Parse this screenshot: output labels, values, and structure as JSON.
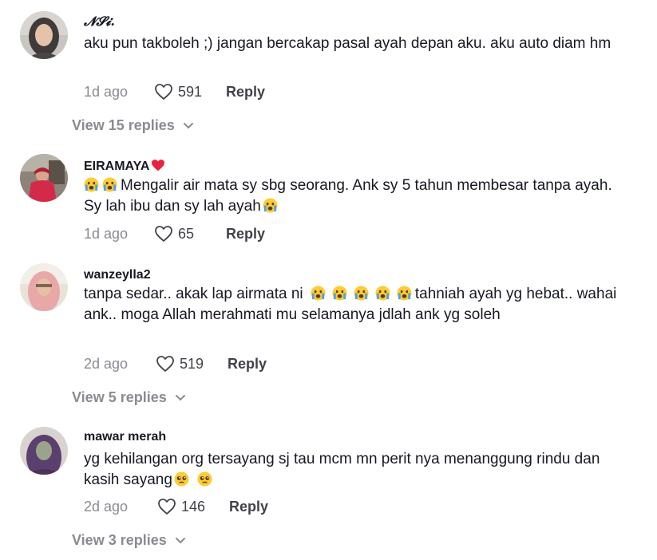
{
  "comments": [
    {
      "username": "𝓝𝓢𝓲.",
      "text": "aku pun takboleh ;) jangan bercakap pasal ayah depan aku. aku auto diam hm",
      "time": "1d ago",
      "likes": "591",
      "reply_label": "Reply",
      "view_replies": "View 15 replies"
    },
    {
      "username": "EIRAMAYA",
      "username_emoji": "red-heart-icon",
      "text_a": "Mengalir air mata sy sbg seorang. Ank sy 5 tahun membesar tanpa ayah. Sy lah ibu dan sy lah ayah",
      "time": "1d ago",
      "likes": "65",
      "reply_label": "Reply"
    },
    {
      "username": "wanzeylla2",
      "text_a": "tanpa sedar.. akak lap airmata ni",
      "text_b": "tahniah ayah yg hebat.. wahai ank.. moga Allah merahmati mu selamanya jdlah ank yg soleh",
      "time": "2d ago",
      "likes": "519",
      "reply_label": "Reply",
      "view_replies": "View 5 replies"
    },
    {
      "username": "mawar merah",
      "text": "yg kehilangan org tersayang sj tau mcm mn perit nya menanggung rindu dan kasih sayang",
      "time": "2d ago",
      "likes": "146",
      "reply_label": "Reply",
      "view_replies": "View 3 replies"
    }
  ],
  "colors": {
    "primary_text": "#161823",
    "secondary_text": "#8a8b91",
    "action_text": "#414249",
    "heart_red": "#e8243c",
    "emoji_yellow": "#ffcc33"
  }
}
